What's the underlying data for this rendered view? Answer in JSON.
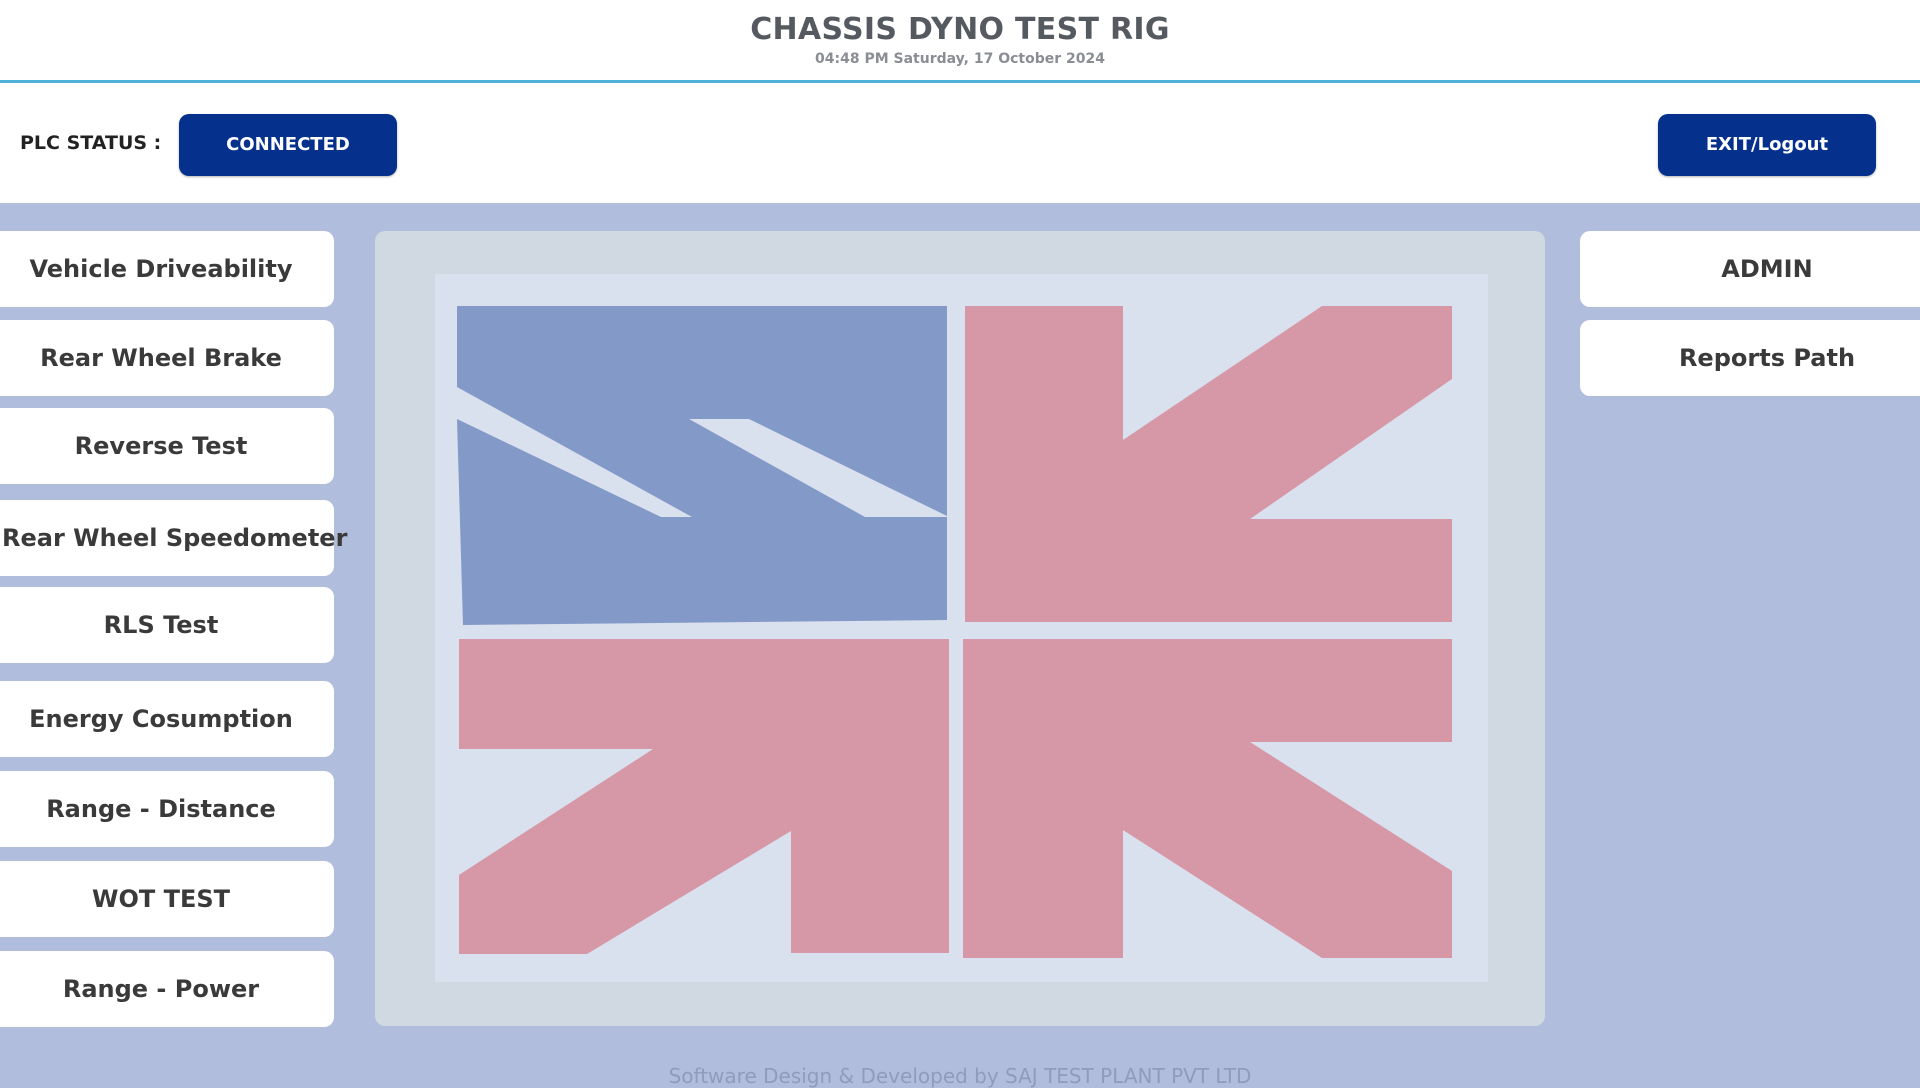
{
  "header": {
    "title": "CHASSIS DYNO TEST RIG",
    "datetime": "04:48 PM Saturday, 17 October 2024"
  },
  "status_bar": {
    "plc_label": "PLC STATUS :",
    "plc_status": "CONNECTED",
    "exit_label": "EXIT/Logout"
  },
  "left_menu": {
    "items": [
      {
        "label": "Vehicle Driveability"
      },
      {
        "label": "Rear Wheel Brake"
      },
      {
        "label": "Reverse Test"
      },
      {
        "label": "Rear Wheel Speedometer"
      },
      {
        "label": "RLS Test"
      },
      {
        "label": "Energy Cosumption"
      },
      {
        "label": "Range - Distance"
      },
      {
        "label": "WOT TEST"
      },
      {
        "label": "Range - Power"
      }
    ]
  },
  "right_menu": {
    "items": [
      {
        "label": "ADMIN"
      },
      {
        "label": "Reports Path"
      }
    ]
  },
  "logo": {
    "icon": "company-logo-icon",
    "colors": {
      "blue": "#8399c7",
      "pink": "#d698a6",
      "background": "#d9e0ee"
    }
  },
  "footer": {
    "credit": "Software Design & Developed by SAJ TEST PLANT PVT LTD"
  },
  "colors": {
    "primary_button": "#05318d",
    "page_background": "#b0bddc",
    "header_accent": "#4fb0d8"
  }
}
